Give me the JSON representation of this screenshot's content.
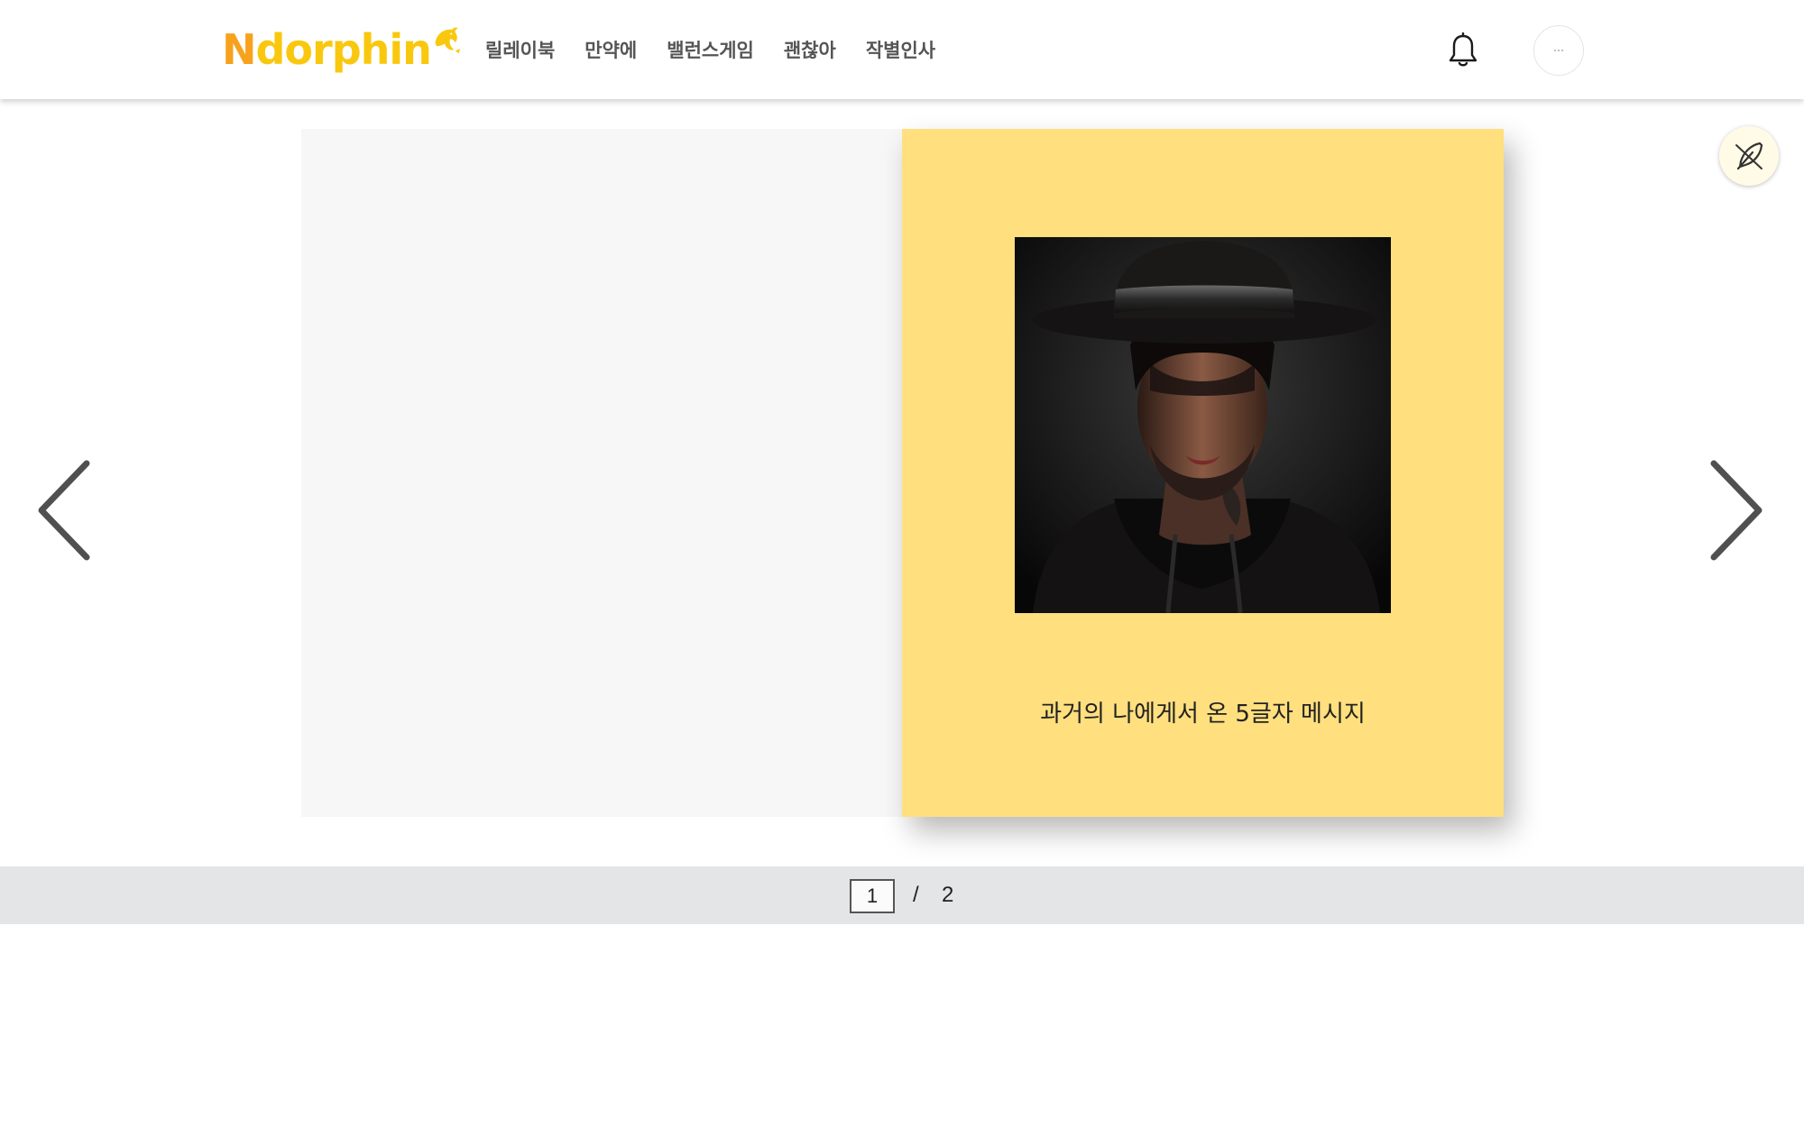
{
  "header": {
    "logo": {
      "n": "N",
      "rest": "dorphin"
    },
    "nav": [
      {
        "label": "릴레이북"
      },
      {
        "label": "만약에"
      },
      {
        "label": "밸런스게임"
      },
      {
        "label": "괜찮아"
      },
      {
        "label": "작별인사"
      }
    ],
    "icons": {
      "notifications": "bell-icon",
      "profile": "avatar"
    }
  },
  "book": {
    "cover_title": "과거의 나에게서 온 5글자 메시지",
    "cover_image": "man-in-black-hat-portrait",
    "colors": {
      "left_page": "#f7f7f7",
      "right_page": "#ffdf7e"
    }
  },
  "navigation": {
    "prev_icon": "chevron-left-icon",
    "next_icon": "chevron-right-icon",
    "float_icon": "feather-pen-icon"
  },
  "pagination": {
    "current": "1",
    "separator": "/",
    "total": "2"
  },
  "colors": {
    "brand_orange": "#f7a21c",
    "brand_yellow": "#f9c80e",
    "nav_text": "#555555",
    "pager_bar": "#e4e5e7"
  }
}
